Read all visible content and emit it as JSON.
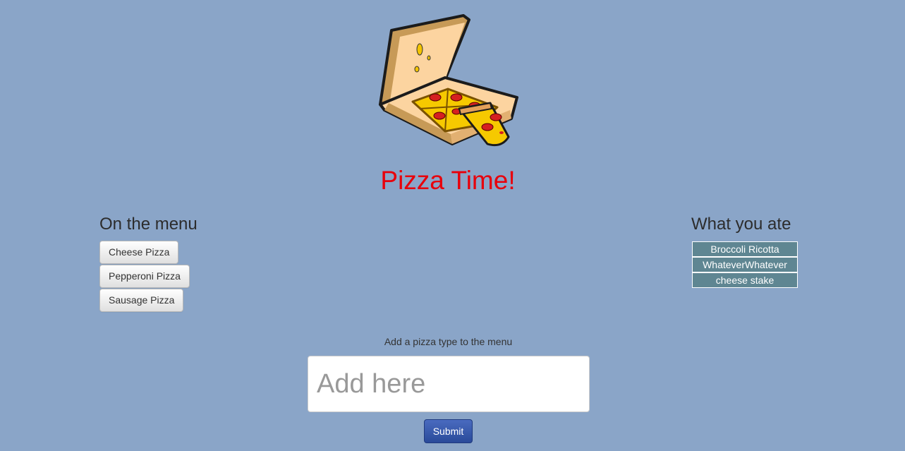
{
  "header": {
    "logo_icon": "pizza-box-icon",
    "title": "Pizza Time!"
  },
  "menu": {
    "heading": "On the menu",
    "items": [
      {
        "label": "Cheese Pizza"
      },
      {
        "label": "Pepperoni Pizza"
      },
      {
        "label": "Sausage Pizza"
      }
    ]
  },
  "eaten": {
    "heading": "What you ate",
    "items": [
      {
        "label": "Broccoli Ricotta"
      },
      {
        "label": "WhateverWhatever"
      },
      {
        "label": "cheese stake"
      }
    ]
  },
  "add_form": {
    "label": "Add a pizza type to the menu",
    "placeholder": "Add here",
    "value": "",
    "submit_label": "Submit"
  },
  "colors": {
    "background": "#8aa5c8",
    "title": "#e8000b",
    "eaten_item_bg": "#5f8692",
    "submit_bg": "#2f52a8"
  }
}
